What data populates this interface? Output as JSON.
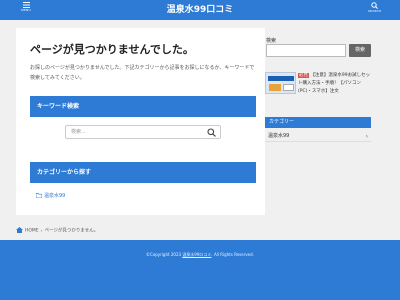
{
  "header": {
    "menu_label": "MENU",
    "site_title": "温泉水99口コミ",
    "search_label": "SEARCH"
  },
  "main": {
    "title": "ページが見つかりませんでした。",
    "message": "お探しのページが見つかりませんでした。下記カテゴリーから記事をお探しになるか、キーワードで検索してみてください。",
    "keyword_heading": "キーワード検索",
    "search_placeholder": "検索...",
    "category_heading": "カテゴリーから探す",
    "categories": [
      "温泉水99"
    ]
  },
  "sidebar": {
    "search_label": "検索",
    "search_button": "検索",
    "popular_post": {
      "tag": "必見",
      "title": "【注意】温泉水99お試しセット購入方法・手順！【パソコン(PC)・スマホ】注文"
    },
    "category_heading": "カテゴリー",
    "category_items": [
      "温泉水99"
    ]
  },
  "breadcrumb": {
    "home": "HOME",
    "separator": "›",
    "current": "ページが見つかりません。"
  },
  "footer": {
    "copyright_prefix": "©Copyright 2023",
    "site_link": "温泉水99口コミ",
    "copyright_suffix": ". All Rights Reserved."
  },
  "colors": {
    "accent": "#2e7bd6",
    "background": "#f0f0f0"
  }
}
